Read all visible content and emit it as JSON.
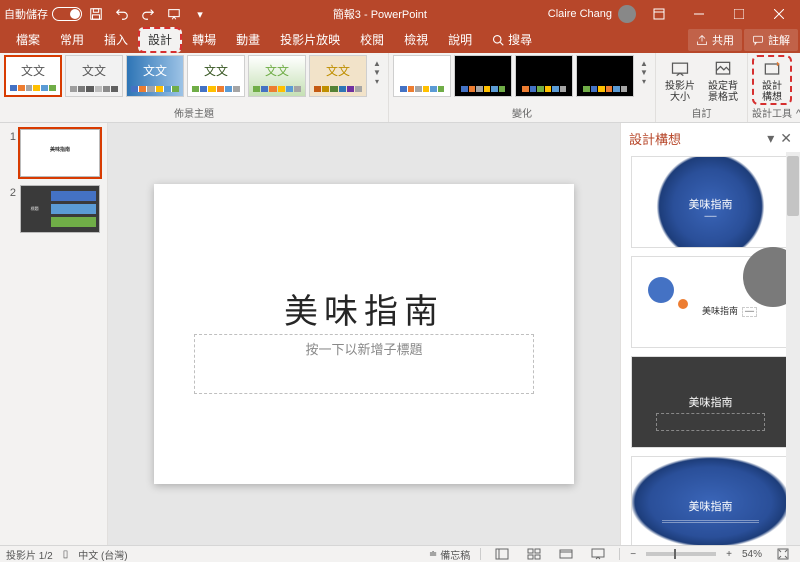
{
  "titlebar": {
    "autosave_label": "自動儲存",
    "autosave_state": "關閉",
    "title": "簡報3 - PowerPoint",
    "user": "Claire Chang"
  },
  "tabs": {
    "items": [
      "檔案",
      "常用",
      "插入",
      "設計",
      "轉場",
      "動畫",
      "投影片放映",
      "校閱",
      "檢視",
      "說明"
    ],
    "active_index": 3,
    "highlight_index": 3,
    "search_placeholder": "搜尋",
    "share": "共用",
    "comments": "註解"
  },
  "ribbon": {
    "themes_label": "佈景主題",
    "variants_label": "變化",
    "customize_label": "自訂",
    "design_tools_label": "設計工具",
    "slide_size": "投影片\n大小",
    "format_bg": "設定背\n景格式",
    "design_ideas": "設計\n構想",
    "theme_text": "文文"
  },
  "slides": {
    "items": [
      {
        "num": "1",
        "type": "title",
        "title": "美味指南"
      },
      {
        "num": "2",
        "type": "content"
      }
    ]
  },
  "canvas": {
    "title": "美味指南",
    "subtitle_placeholder": "按一下以新增子標題"
  },
  "design_pane": {
    "header": "設計構想",
    "idea_title": "美味指南"
  },
  "status": {
    "slide_counter": "投影片 1/2",
    "language": "中文 (台灣)",
    "notes": "備忘稿",
    "zoom": "54%"
  }
}
